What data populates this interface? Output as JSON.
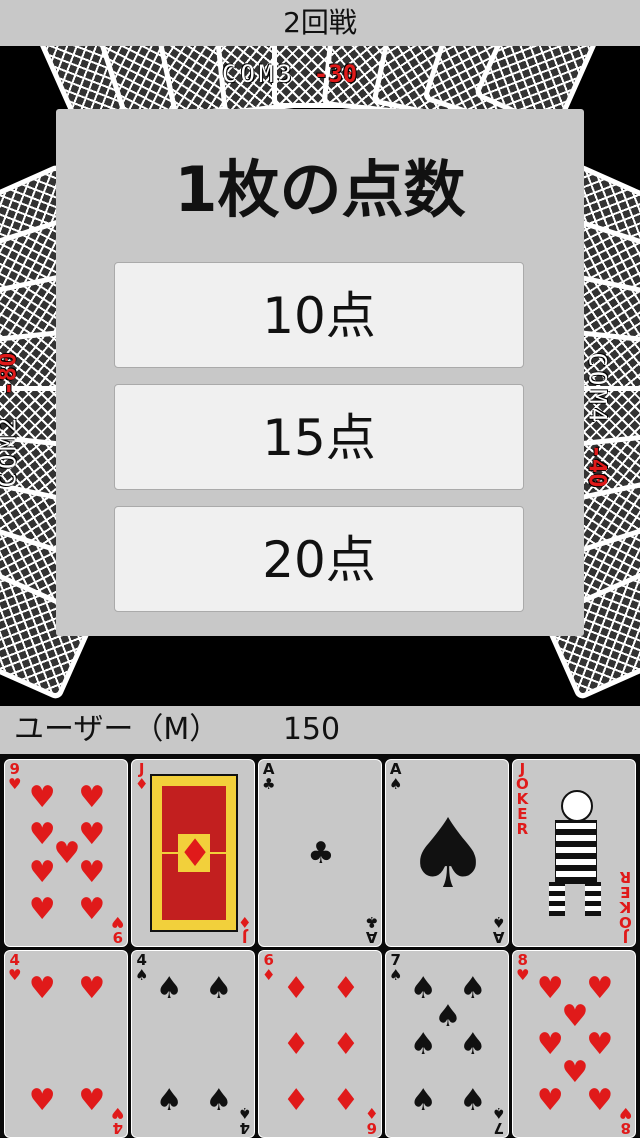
{
  "header": {
    "title": "2回戦"
  },
  "opponents": [
    {
      "name": "COM3",
      "score": "-30"
    },
    {
      "name": "COM2",
      "score": "-80"
    },
    {
      "name": "COM4",
      "score": "-40"
    }
  ],
  "dialog": {
    "title": "1枚の点数",
    "options": [
      "10点",
      "15点",
      "20点"
    ]
  },
  "user": {
    "name": "ユーザー（M）",
    "score": "150"
  },
  "hand": [
    {
      "rank": "9",
      "suit": "♥",
      "color": "red",
      "label": "9 of hearts"
    },
    {
      "rank": "J",
      "suit": "♦",
      "color": "red",
      "label": "jack of diamonds"
    },
    {
      "rank": "A",
      "suit": "♣",
      "color": "black",
      "label": "ace of clubs"
    },
    {
      "rank": "A",
      "suit": "♠",
      "color": "black",
      "label": "ace of spades"
    },
    {
      "rank": "JOKER",
      "suit": "",
      "color": "red",
      "label": "joker"
    },
    {
      "rank": "4",
      "suit": "♥",
      "color": "red",
      "label": "4 of hearts"
    },
    {
      "rank": "4",
      "suit": "♠",
      "color": "black",
      "label": "4 of spades"
    },
    {
      "rank": "6",
      "suit": "♦",
      "color": "red",
      "label": "6 of diamonds"
    },
    {
      "rank": "7",
      "suit": "♠",
      "color": "black",
      "label": "7 of spades"
    },
    {
      "rank": "8",
      "suit": "♥",
      "color": "red",
      "label": "8 of hearts"
    }
  ]
}
